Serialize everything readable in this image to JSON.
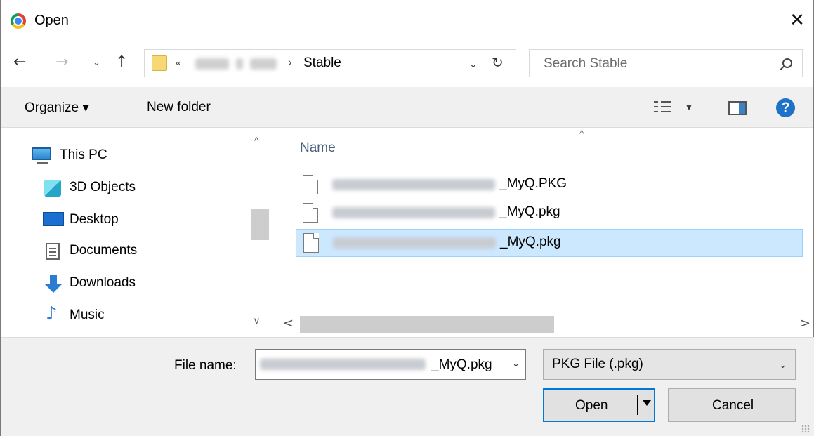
{
  "window": {
    "title": "Open",
    "close_glyph": "✕"
  },
  "nav": {
    "back_glyph": "←",
    "forward_glyph": "→",
    "recent_glyph": "⌄",
    "up_glyph": "↑",
    "breadcrumb_more": "«",
    "breadcrumb_separator": "›",
    "current_folder": "Stable",
    "dropdown_glyph": "⌄",
    "refresh_glyph": "↻",
    "search_placeholder": "Search Stable"
  },
  "toolbar": {
    "organize_label": "Organize ▾",
    "new_folder_label": "New folder",
    "view_arrow": "▼",
    "help_glyph": "?"
  },
  "navpane": {
    "items": [
      {
        "label": "This PC",
        "icon": "computer-icon"
      },
      {
        "label": "3D Objects",
        "icon": "3d-objects-icon"
      },
      {
        "label": "Desktop",
        "icon": "desktop-icon"
      },
      {
        "label": "Documents",
        "icon": "documents-icon"
      },
      {
        "label": "Downloads",
        "icon": "downloads-icon"
      },
      {
        "label": "Music",
        "icon": "music-icon"
      }
    ],
    "scroll_up": "^",
    "scroll_down": "v"
  },
  "filelist": {
    "column_name": "Name",
    "sort_caret": "^",
    "files": [
      {
        "name_suffix": "_MyQ.PKG",
        "selected": false
      },
      {
        "name_suffix": "_MyQ.pkg",
        "selected": false
      },
      {
        "name_suffix": "_MyQ.pkg",
        "selected": true
      }
    ],
    "scroll_left": "<",
    "scroll_right": ">"
  },
  "bottom": {
    "file_name_label": "File name:",
    "file_name_suffix": "_MyQ.pkg",
    "file_name_drop": "⌄",
    "file_type_value": "PKG File (.pkg)",
    "file_type_drop": "⌄",
    "open_label": "Open",
    "cancel_label": "Cancel"
  },
  "colors": {
    "accent": "#0078d7",
    "selection": "#cce8ff",
    "help_blue": "#1e72c8"
  }
}
